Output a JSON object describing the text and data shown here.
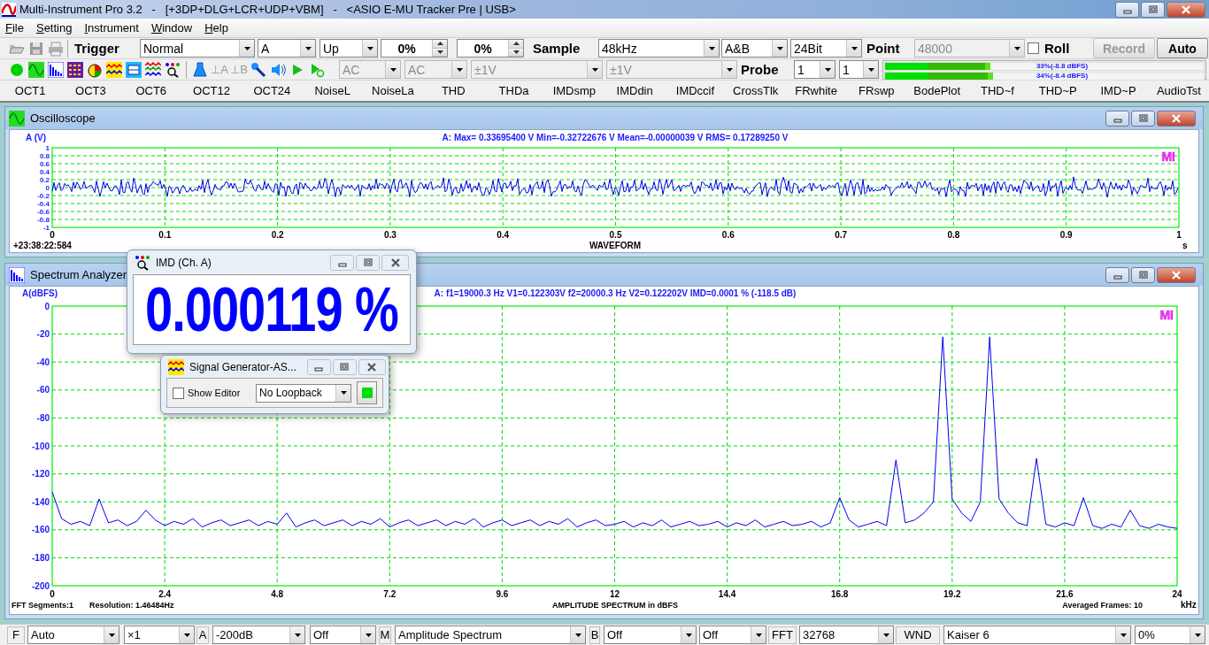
{
  "window": {
    "title": "Multi-Instrument Pro 3.2   -   [+3DP+DLG+LCR+UDP+VBM]   -   <ASIO E-MU Tracker Pre | USB>"
  },
  "menu": [
    "File",
    "Setting",
    "Instrument",
    "Window",
    "Help"
  ],
  "toolbar": [
    {
      "kind": "label",
      "text": "Trigger"
    },
    {
      "kind": "combo",
      "value": "Normal",
      "disabled": false
    },
    {
      "kind": "combo",
      "value": "A",
      "disabled": false
    },
    {
      "kind": "combo",
      "value": "Up",
      "disabled": false
    },
    {
      "kind": "spin",
      "value": "0%"
    },
    {
      "kind": "spin",
      "value": "0%"
    },
    {
      "kind": "label",
      "text": "Sample"
    },
    {
      "kind": "combo",
      "value": "48kHz",
      "disabled": false
    },
    {
      "kind": "combo",
      "value": "A&B",
      "disabled": false
    },
    {
      "kind": "combo",
      "value": "24Bit",
      "disabled": false
    },
    {
      "kind": "label",
      "text": "Point"
    },
    {
      "kind": "combo",
      "value": "48000",
      "disabled": true
    },
    {
      "kind": "check",
      "label": "Roll",
      "checked": false
    },
    {
      "kind": "button",
      "label": "Record",
      "disabled": true
    },
    {
      "kind": "button",
      "label": "Auto",
      "disabled": false
    }
  ],
  "toolbar2": {
    "channel_buttons": [
      {
        "label": "⊥A",
        "disabled": true
      },
      {
        "label": "⊥B",
        "disabled": true
      }
    ],
    "controls": [
      {
        "kind": "combo",
        "value": "AC",
        "disabled": true
      },
      {
        "kind": "combo",
        "value": "AC",
        "disabled": true
      },
      {
        "kind": "combo",
        "value": "±1V",
        "disabled": true
      },
      {
        "kind": "combo",
        "value": "±1V",
        "disabled": true
      },
      {
        "kind": "label",
        "text": "Probe"
      },
      {
        "kind": "combo",
        "value": "1",
        "disabled": false
      },
      {
        "kind": "combo",
        "value": "1",
        "disabled": false
      }
    ],
    "meters": [
      {
        "level": 0.33,
        "reading": "33%(-8.8 dBFS)"
      },
      {
        "level": 0.34,
        "reading": "34%(-8.4 dBFS)"
      }
    ]
  },
  "macro_buttons": [
    "OCT1",
    "OCT3",
    "OCT6",
    "OCT12",
    "OCT24",
    "NoiseL",
    "NoiseLa",
    "THD",
    "THDa",
    "IMDsmp",
    "IMDdin",
    "IMDccif",
    "CrossTlk",
    "FRwhite",
    "FRswp",
    "BodePlot",
    "THD~f",
    "THD~P",
    "IMD~P",
    "AudioTst"
  ],
  "oscilloscope": {
    "title": "Oscilloscope",
    "axis_title": "A (V)",
    "readout": "A: Max= 0.33695400 V  Min=-0.32722676 V  Mean=-0.00000039 V  RMS= 0.17289250 V",
    "y_ticks": [
      "1",
      "0.8",
      "0.6",
      "0.4",
      "0.2",
      "0",
      "-0.2",
      "-0.4",
      "-0.6",
      "-0.8",
      "-1"
    ],
    "x_ticks": [
      "0",
      "0.1",
      "0.2",
      "0.3",
      "0.4",
      "0.5",
      "0.6",
      "0.7",
      "0.8",
      "0.9",
      "1"
    ],
    "x_unit": "s",
    "timestamp": "+23:38:22:584",
    "x_title": "WAVEFORM",
    "logo": "MI"
  },
  "spectrum": {
    "title": "Spectrum Analyzer",
    "readout": "A: f1=19000.3 Hz V1=0.122303V  f2=20000.3 Hz V2=0.122202V  IMD=0.0001 % (-118.5 dB)",
    "x_unit": "kHz",
    "status_left": [
      "FFT Segments:1",
      "Resolution: 1.46484Hz"
    ],
    "status_right": "Averaged Frames: 10",
    "logo": "MI",
    "chart_data": {
      "type": "line",
      "grid": true,
      "ylabel": "A(dBFS)",
      "xlabel": "AMPLITUDE SPECTRUM in dBFS",
      "xlim": [
        0,
        24
      ],
      "ylim": [
        -200,
        0
      ],
      "xticks": [
        0,
        2.4,
        4.8,
        7.2,
        9.6,
        12,
        14.4,
        16.8,
        19.2,
        21.6,
        24
      ],
      "yticks": [
        0,
        -20,
        -40,
        -60,
        -80,
        -100,
        -120,
        -140,
        -160,
        -180,
        -200
      ],
      "x": [
        0,
        0.2,
        0.4,
        0.6,
        0.8,
        1,
        1.2,
        1.4,
        1.6,
        1.8,
        2,
        2.2,
        2.4,
        2.6,
        2.8,
        3,
        3.2,
        3.4,
        3.6,
        3.8,
        4,
        4.2,
        4.4,
        4.6,
        4.8,
        5,
        5.2,
        5.4,
        5.6,
        5.8,
        6,
        6.2,
        6.4,
        6.6,
        6.8,
        7,
        7.2,
        7.4,
        7.6,
        7.8,
        8,
        8.2,
        8.4,
        8.6,
        8.8,
        9,
        9.2,
        9.4,
        9.6,
        9.8,
        10,
        10.2,
        10.4,
        10.6,
        10.8,
        11,
        11.2,
        11.4,
        11.6,
        11.8,
        12,
        12.2,
        12.4,
        12.6,
        12.8,
        13,
        13.2,
        13.4,
        13.6,
        13.8,
        14,
        14.2,
        14.4,
        14.6,
        14.8,
        15,
        15.2,
        15.4,
        15.6,
        15.8,
        16,
        16.2,
        16.4,
        16.6,
        16.8,
        17,
        17.2,
        17.4,
        17.6,
        17.8,
        18,
        18.2,
        18.4,
        18.6,
        18.8,
        19,
        19.2,
        19.4,
        19.6,
        19.8,
        20,
        20.2,
        20.4,
        20.6,
        20.8,
        21,
        21.2,
        21.4,
        21.6,
        21.8,
        22,
        22.2,
        22.4,
        22.6,
        22.8,
        23,
        23.2,
        23.4,
        23.6,
        23.8,
        24
      ],
      "series": [
        {
          "color": "#0000ee",
          "values": [
            -133,
            -152,
            -156,
            -154,
            -157,
            -138,
            -155,
            -153,
            -157,
            -154,
            -146,
            -153,
            -157,
            -154,
            -156,
            -152,
            -158,
            -155,
            -153,
            -157,
            -155,
            -153,
            -157,
            -154,
            -156,
            -148,
            -158,
            -155,
            -153,
            -157,
            -155,
            -153,
            -157,
            -154,
            -156,
            -152,
            -158,
            -155,
            -153,
            -157,
            -155,
            -153,
            -157,
            -154,
            -156,
            -152,
            -158,
            -155,
            -153,
            -157,
            -155,
            -153,
            -157,
            -154,
            -156,
            -152,
            -158,
            -155,
            -153,
            -157,
            -156,
            -154,
            -158,
            -155,
            -157,
            -153,
            -158,
            -156,
            -154,
            -157,
            -156,
            -154,
            -158,
            -155,
            -157,
            -153,
            -158,
            -156,
            -154,
            -157,
            -156,
            -154,
            -158,
            -155,
            -137,
            -153,
            -158,
            -156,
            -154,
            -157,
            -110,
            -155,
            -153,
            -148,
            -140,
            -22,
            -138,
            -148,
            -154,
            -140,
            -22,
            -138,
            -148,
            -155,
            -157,
            -109,
            -156,
            -158,
            -155,
            -157,
            -137,
            -157,
            -159,
            -156,
            -158,
            -146,
            -157,
            -159,
            -156,
            -158,
            -159
          ]
        }
      ]
    }
  },
  "imd_window": {
    "title": "IMD (Ch. A)",
    "value": "0.000119 %"
  },
  "generator_window": {
    "title": "Signal Generator-AS...",
    "show_editor": {
      "label": "Show Editor",
      "checked": false
    },
    "loopback": {
      "value": "No Loopback",
      "disabled": false
    }
  },
  "bottom_bar": [
    {
      "kind": "label",
      "text": "F"
    },
    {
      "kind": "combo",
      "value": "Auto",
      "disabled": false
    },
    {
      "kind": "combo",
      "value": "×1",
      "disabled": false
    },
    {
      "kind": "label",
      "text": "A"
    },
    {
      "kind": "combo",
      "value": "-200dB",
      "disabled": false
    },
    {
      "kind": "combo",
      "value": "Off",
      "disabled": false
    },
    {
      "kind": "label",
      "text": "M"
    },
    {
      "kind": "combo",
      "value": "Amplitude Spectrum",
      "disabled": false
    },
    {
      "kind": "label",
      "text": "B"
    },
    {
      "kind": "combo",
      "value": "Off",
      "disabled": false
    },
    {
      "kind": "combo",
      "value": "Off",
      "disabled": false
    },
    {
      "kind": "label",
      "text": "FFT"
    },
    {
      "kind": "combo",
      "value": "32768",
      "disabled": false
    },
    {
      "kind": "label",
      "text": "WND"
    },
    {
      "kind": "combo",
      "value": "Kaiser 6",
      "disabled": false
    },
    {
      "kind": "combo",
      "value": "0%",
      "disabled": false
    }
  ]
}
